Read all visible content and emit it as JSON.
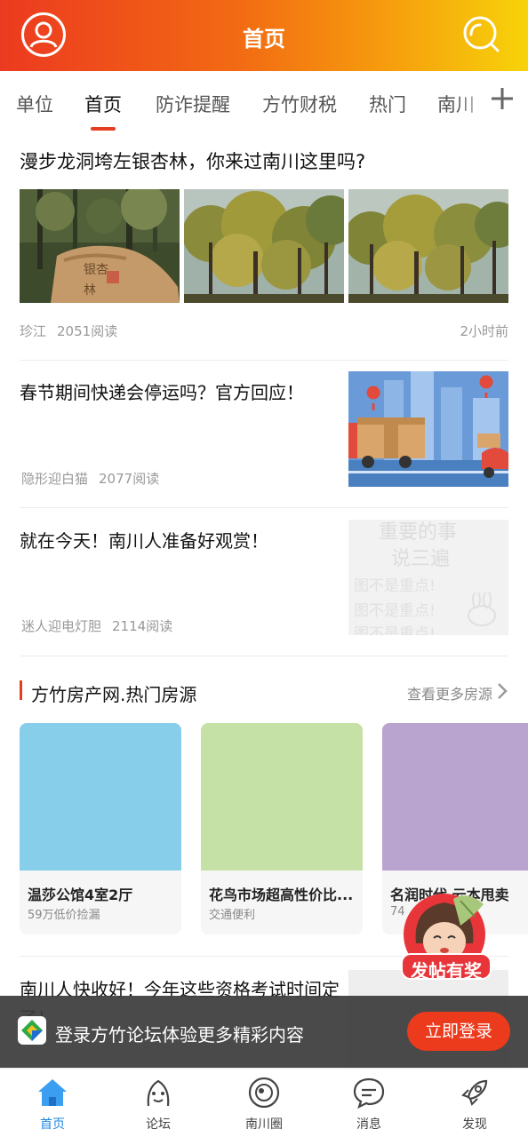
{
  "header": {
    "title": "首页",
    "left_icon": "user-icon",
    "right_icon": "search-icon"
  },
  "tabs": [
    {
      "label": "单位"
    },
    {
      "label": "首页",
      "active": true
    },
    {
      "label": "防诈提醒"
    },
    {
      "label": "方竹财税"
    },
    {
      "label": "热门"
    },
    {
      "label": "南川"
    }
  ],
  "tabs_add_icon": "plus-icon",
  "feed": {
    "article1": {
      "title": "漫步龙洞垮左银杏林，你来过南川这里吗?",
      "author": "珍江",
      "reads": "2051阅读",
      "time": "2小时前",
      "stone_text": "古银杏林"
    },
    "article2": {
      "title": "春节期间快递会停运吗？官方回应！",
      "author": "隐形迎白猫",
      "reads": "2077阅读"
    },
    "article3": {
      "title": "就在今天！南川人准备好观赏！",
      "author": "迷人迎电灯胆",
      "reads": "2114阅读",
      "thumb_lines": [
        "重要的事",
        "说三遍",
        "图不是重点!",
        "图不是重点!",
        "图不是重点!"
      ]
    },
    "article4": {
      "title": "南川人快收好！今年这些资格考试时间定了！"
    }
  },
  "section": {
    "title": "方竹房产网.热门房源",
    "more": "查看更多房源",
    "cards": [
      {
        "title": "温莎公馆4室2厅",
        "sub": "59万低价捡漏",
        "color": "#87ceeb"
      },
      {
        "title": "花鸟市场超高性价比...",
        "sub": "交通便利",
        "color": "#c5e1a5"
      },
      {
        "title": "名润时代 云本甩卖",
        "sub": "74",
        "color": "#b9a3cf"
      }
    ]
  },
  "badge": {
    "text": "发帖有奖"
  },
  "login": {
    "text": "登录方竹论坛体验更多精彩内容",
    "button": "立即登录"
  },
  "nav": [
    {
      "label": "首页",
      "icon": "home-icon",
      "active": true
    },
    {
      "label": "论坛",
      "icon": "forum-icon"
    },
    {
      "label": "南川圈",
      "icon": "circle-icon"
    },
    {
      "label": "消息",
      "icon": "message-icon"
    },
    {
      "label": "发现",
      "icon": "rocket-icon"
    }
  ],
  "colors": {
    "accent": "#e63c20",
    "nav_active": "#1f86e0"
  }
}
